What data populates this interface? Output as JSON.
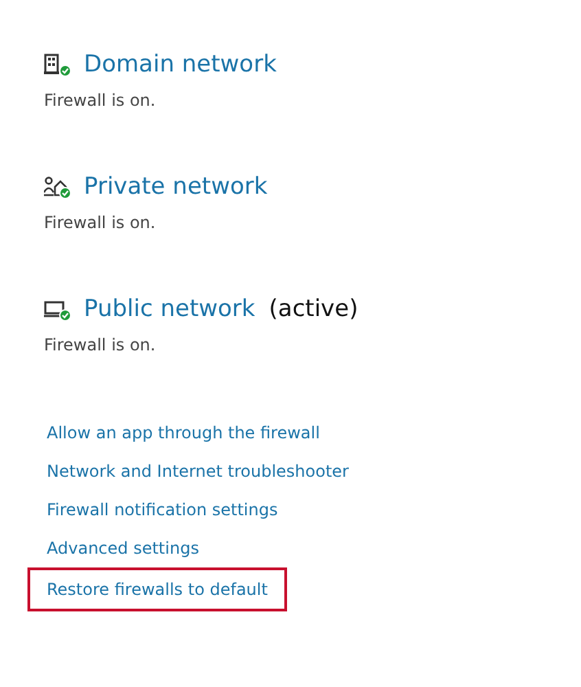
{
  "networks": [
    {
      "kind": "domain",
      "name": "Domain network",
      "status": "Firewall is on."
    },
    {
      "kind": "private",
      "name": "Private network",
      "status": "Firewall is on."
    },
    {
      "kind": "public",
      "name": "Public network",
      "note": "(active)",
      "status": "Firewall is on."
    }
  ],
  "links": [
    {
      "label": "Allow an app through the firewall",
      "highlighted": false
    },
    {
      "label": "Network and Internet troubleshooter",
      "highlighted": false
    },
    {
      "label": "Firewall notification settings",
      "highlighted": false
    },
    {
      "label": "Advanced settings",
      "highlighted": false
    },
    {
      "label": "Restore firewalls to default",
      "highlighted": true
    }
  ]
}
